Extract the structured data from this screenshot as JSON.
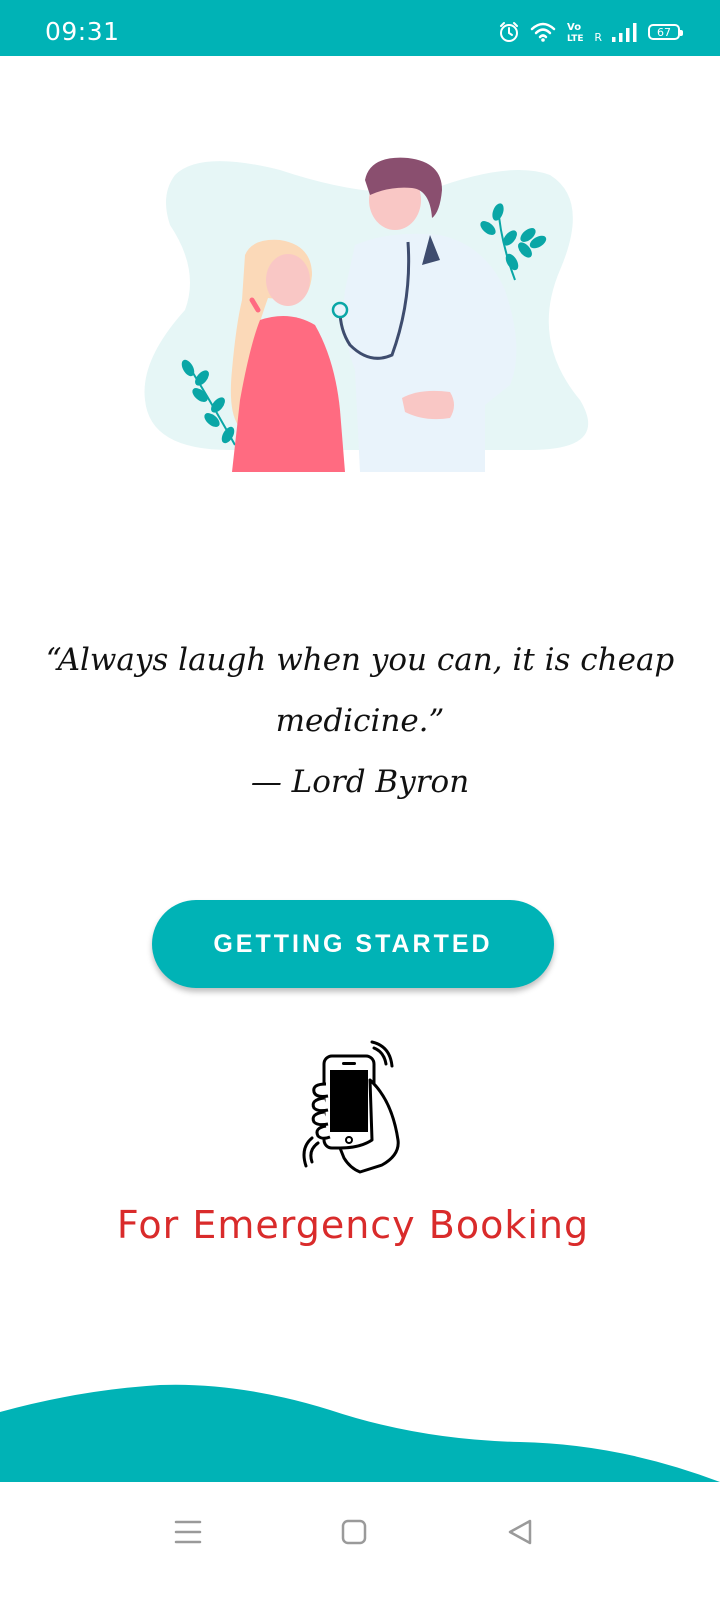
{
  "status_bar": {
    "time": "09:31",
    "battery": "67",
    "network_r": "R",
    "icons": [
      "alarm-icon",
      "wifi-icon",
      "volte-icon",
      "signal-icon",
      "battery-icon"
    ]
  },
  "quote": {
    "line1": "“Always laugh when you can, it is cheap",
    "line2": "medicine.”",
    "author": "— Lord Byron"
  },
  "getting_started_label": "GETTING STARTED",
  "emergency_label": "For Emergency Booking",
  "nav": {
    "icons": [
      "menu-icon",
      "home-square-icon",
      "back-triangle-icon"
    ]
  },
  "colors": {
    "accent": "#00b3b6",
    "emergency_text": "#d92b2b",
    "hero_blob": "#e6f6f6"
  }
}
